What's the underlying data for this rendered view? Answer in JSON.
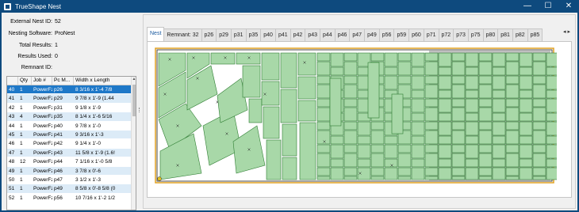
{
  "window": {
    "title": "TrueShape Nest",
    "minimize": "—",
    "maximize": "☐",
    "close": "✕"
  },
  "info": {
    "external_nest_id": {
      "label": "External Nest ID:",
      "value": "52"
    },
    "nesting_software": {
      "label": "Nesting Software:",
      "value": "ProNest"
    },
    "total_results": {
      "label": "Total Results:",
      "value": "1"
    },
    "results_used": {
      "label": "Results Used:",
      "value": "0"
    },
    "remnant_id": {
      "label": "Remnant ID:",
      "value": ""
    }
  },
  "grid": {
    "headers": [
      "",
      "Qty",
      "Job #",
      "Pc M...",
      "Width x Length"
    ],
    "rows": [
      [
        "40",
        "1",
        "PowerFz",
        "p26",
        "8 3/16 x 1'-4 7/8"
      ],
      [
        "41",
        "1",
        "PowerFz",
        "p29",
        "9 7/8 x 1'-9  (1.44"
      ],
      [
        "42",
        "1",
        "PowerFz",
        "p31",
        "9 1/8 x 1'-9"
      ],
      [
        "43",
        "4",
        "PowerFz",
        "p35",
        "8 1/4 x 1'-6 5/16"
      ],
      [
        "44",
        "1",
        "PowerFz",
        "p40",
        "9 7/8 x 1'-0"
      ],
      [
        "45",
        "1",
        "PowerFz",
        "p41",
        "9 3/16 x 1'-3"
      ],
      [
        "46",
        "1",
        "PowerFz",
        "p42",
        "9 1/4 x 1'-0"
      ],
      [
        "47",
        "1",
        "PowerFz",
        "p43",
        "11 5/8 x 1'-9  (1.6!"
      ],
      [
        "48",
        "12",
        "PowerFz",
        "p44",
        "7 1/16 x 1'-0 5/8"
      ],
      [
        "49",
        "1",
        "PowerFz",
        "p46",
        "3 7/8 x 0'-6"
      ],
      [
        "50",
        "1",
        "PowerFz",
        "p47",
        "3 1/2 x 1'-3"
      ],
      [
        "51",
        "1",
        "PowerFz",
        "p49",
        "8 5/8 x 0'-8 5/8  (0"
      ],
      [
        "52",
        "1",
        "PowerFz",
        "p56",
        "10 7/16 x 1'-2 1/2"
      ]
    ],
    "selected_index": 0
  },
  "tabs": [
    "Nest",
    "Remnant: 32",
    "p26",
    "p29",
    "p31",
    "p35",
    "p40",
    "p41",
    "p42",
    "p43",
    "p44",
    "p46",
    "p47",
    "p49",
    "p56",
    "p59",
    "p60",
    "p71",
    "p72",
    "p73",
    "p75",
    "p80",
    "p81",
    "p82",
    "p85"
  ],
  "tab_nav": {
    "prev": "◂",
    "next": "▸"
  },
  "colors": {
    "part_fill": "#a8d8a8",
    "part_stroke": "#2e7d32",
    "remnant": "#c0c0c0",
    "sheet_border": "#e0a020"
  }
}
